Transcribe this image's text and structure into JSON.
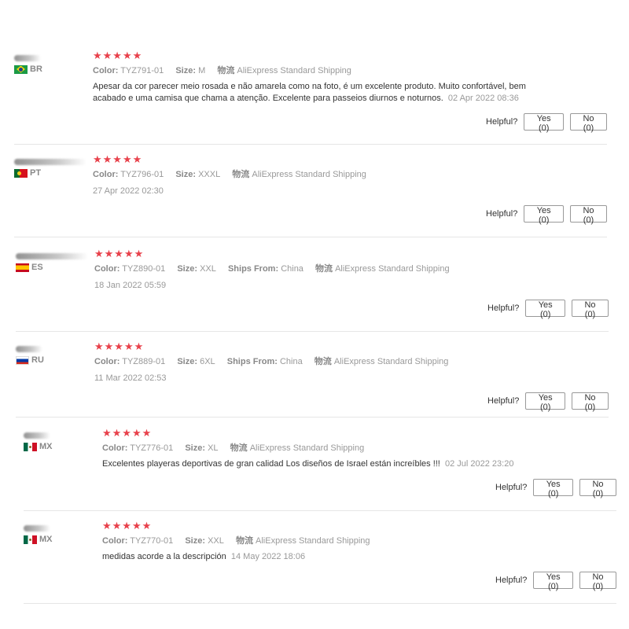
{
  "helpful_label": "Helpful?",
  "labels": {
    "color": "Color:",
    "size": "Size:",
    "ships_from": "Ships From:",
    "shipping_key": "物流"
  },
  "reviews": [
    {
      "country": "BR",
      "stars": "★★★★★",
      "color": "TYZ791-01",
      "size": "M",
      "shipping": "AliExpress Standard Shipping",
      "text": "Apesar da cor parecer meio rosada e não amarela como na foto, é um excelente produto. Muito confortável, bem acabado e uma camisa que chama a atenção. Excelente para passeios diurnos e noturnos.",
      "date": "02 Apr 2022 08:36",
      "yes": "Yes (0)",
      "no": "No (0)"
    },
    {
      "country": "PT",
      "stars": "★★★★★",
      "color": "TYZ796-01",
      "size": "XXXL",
      "shipping": "AliExpress Standard Shipping",
      "date": "27 Apr 2022 02:30",
      "yes": "Yes (0)",
      "no": "No (0)"
    },
    {
      "country": "ES",
      "stars": "★★★★★",
      "color": "TYZ890-01",
      "size": "XXL",
      "ships_from": "China",
      "shipping": "AliExpress Standard Shipping",
      "date": "18 Jan 2022 05:59",
      "yes": "Yes (0)",
      "no": "No (0)"
    },
    {
      "country": "RU",
      "stars": "★★★★★",
      "color": "TYZ889-01",
      "size": "6XL",
      "ships_from": "China",
      "shipping": "AliExpress Standard Shipping",
      "date": "11 Mar 2022 02:53",
      "yes": "Yes (0)",
      "no": "No (0)"
    },
    {
      "country": "MX",
      "stars": "★★★★★",
      "color": "TYZ776-01",
      "size": "XL",
      "shipping": "AliExpress Standard Shipping",
      "text": "Excelentes playeras deportivas de gran calidad Los diseños de Israel están increíbles !!!",
      "date": "02 Jul 2022 23:20",
      "yes": "Yes (0)",
      "no": "No (0)"
    },
    {
      "country": "MX",
      "stars": "★★★★★",
      "color": "TYZ770-01",
      "size": "XXL",
      "shipping": "AliExpress Standard Shipping",
      "text": "medidas acorde a la descripción",
      "date": "14 May 2022 18:06",
      "yes": "Yes (0)",
      "no": "No (0)"
    }
  ]
}
